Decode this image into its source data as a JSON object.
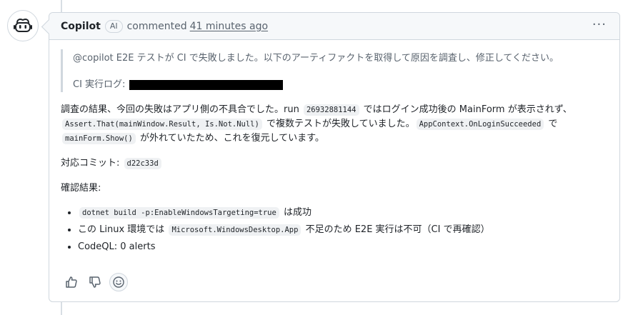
{
  "header": {
    "author": "Copilot",
    "badge": "AI",
    "action": "commented",
    "time": "41 minutes ago",
    "more_label": "···"
  },
  "quote": {
    "line1": "@copilot E2E テストが CI で失敗しました。以下のアーティファクトを取得して原因を調査し、修正してください。",
    "line2_label": "CI 実行ログ:"
  },
  "body": {
    "p1": {
      "t1": "調査の結果、今回の失敗はアプリ側の不具合でした。run ",
      "c1": "26932881144",
      "t2": " ではログイン成功後の MainForm が表示されず、",
      "c2": "Assert.That(mainWindow.Result, Is.Not.Null)",
      "t3": " で複数テストが失敗していました。",
      "c3": "AppContext.OnLoginSucceeded",
      "t4": " で",
      "c4": "mainForm.Show()",
      "t5": " が外れていたため、これを復元しています。"
    },
    "commit_label": "対応コミット: ",
    "commit_hash": "d22c33d",
    "results_label": "確認結果:",
    "results": [
      {
        "code": "dotnet build -p:EnableWindowsTargeting=true",
        "text": " は成功"
      },
      {
        "pre": "この Linux 環境では ",
        "code": "Microsoft.WindowsDesktop.App",
        "text": " 不足のため E2E 実行は不可（CI で再確認）"
      },
      {
        "text": "CodeQL: 0 alerts"
      }
    ]
  },
  "icons": {
    "avatar": "copilot-icon",
    "thumbs_up": "thumbs-up-icon",
    "thumbs_down": "thumbs-down-icon",
    "emoji": "smiley-icon"
  }
}
